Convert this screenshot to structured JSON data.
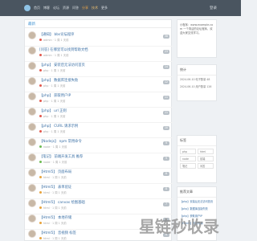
{
  "topbar": {
    "nav": [
      "首页",
      "博客",
      "论坛",
      "资源",
      "问答",
      "分享",
      "技术",
      "更多"
    ],
    "login": "登录"
  },
  "main": {
    "heading": "最新",
    "posts": [
      {
        "title": "【通知】 bbs论坛程序",
        "meta": "admin · 1 周 1 天前",
        "count": "38",
        "dot": "#e2574c"
      },
      {
        "title": "[问答] 在哪里可以找到帮助文档",
        "meta": "admin · 1 周 1 天前",
        "count": "23",
        "dot": "#e2574c"
      },
      {
        "title": "【php】 安装后无法访问首页",
        "meta": "php · 1 周 1 天前",
        "count": "14",
        "dot": "#e2574c"
      },
      {
        "title": "【php】 数据库连接失败",
        "meta": "php · 1 周 1 天前",
        "count": "12",
        "dot": "#e2574c"
      },
      {
        "title": "【php】 获取用户IP",
        "meta": "php · 1 周 1 天前",
        "count": "11",
        "dot": "#e2574c"
      },
      {
        "title": "【php】 url 正则",
        "meta": "php · 1 周 1 天前",
        "count": "11",
        "dot": "#e2574c"
      },
      {
        "title": "【php】 CURL 请求示例",
        "meta": "php · 1 周 1 天前",
        "count": "10",
        "dot": "#e2574c"
      },
      {
        "title": "【Nodejs】 npm 常用命令",
        "meta": "node · 1 周 1 天前",
        "count": "9",
        "dot": "#6dbb52"
      },
      {
        "title": "【笔记】 前端开发工具 推荐",
        "meta": "node · 1 周 1 天前",
        "count": "9",
        "dot": "#6dbb52"
      },
      {
        "title": "【Html5】 页面布局",
        "meta": "html · 1 周 1 天前",
        "count": "8",
        "dot": "#e8a33c"
      },
      {
        "title": "【Html5】 表单验证",
        "meta": "html · 1 周 1 天前",
        "count": "8",
        "dot": "#e8a33c"
      },
      {
        "title": "【Html5】 canvas 绘图基础",
        "meta": "html · 1 周 1 天前",
        "count": "7",
        "dot": "#e8a33c"
      },
      {
        "title": "【Html5】 本地存储",
        "meta": "html · 1 周 1 天前",
        "count": "7",
        "dot": "#e8a33c"
      },
      {
        "title": "【Html5】 音视频 标签",
        "meta": "html · 1 周 1 天前",
        "count": "6",
        "dot": "#e8a33c"
      }
    ]
  },
  "sidebar": {
    "about": "小程序：www.example.com 一个简洁的论坛程序，欢迎大家交流学习。",
    "stats_title": "统计",
    "stats": [
      "2024-06-10 帖子数量 48",
      "2024-06-10 用户数量 126"
    ],
    "tags_title": "标签",
    "tags": [
      "php",
      "html",
      "node",
      "前端",
      "笔记",
      "问答"
    ],
    "rec_title": "推荐文章",
    "rec": [
      "【php】安装后无法访问首页",
      "【php】数据库连接失败",
      "【php】获取用户IP",
      "【Html5】页面布局"
    ]
  },
  "watermark": "星链秒收录"
}
